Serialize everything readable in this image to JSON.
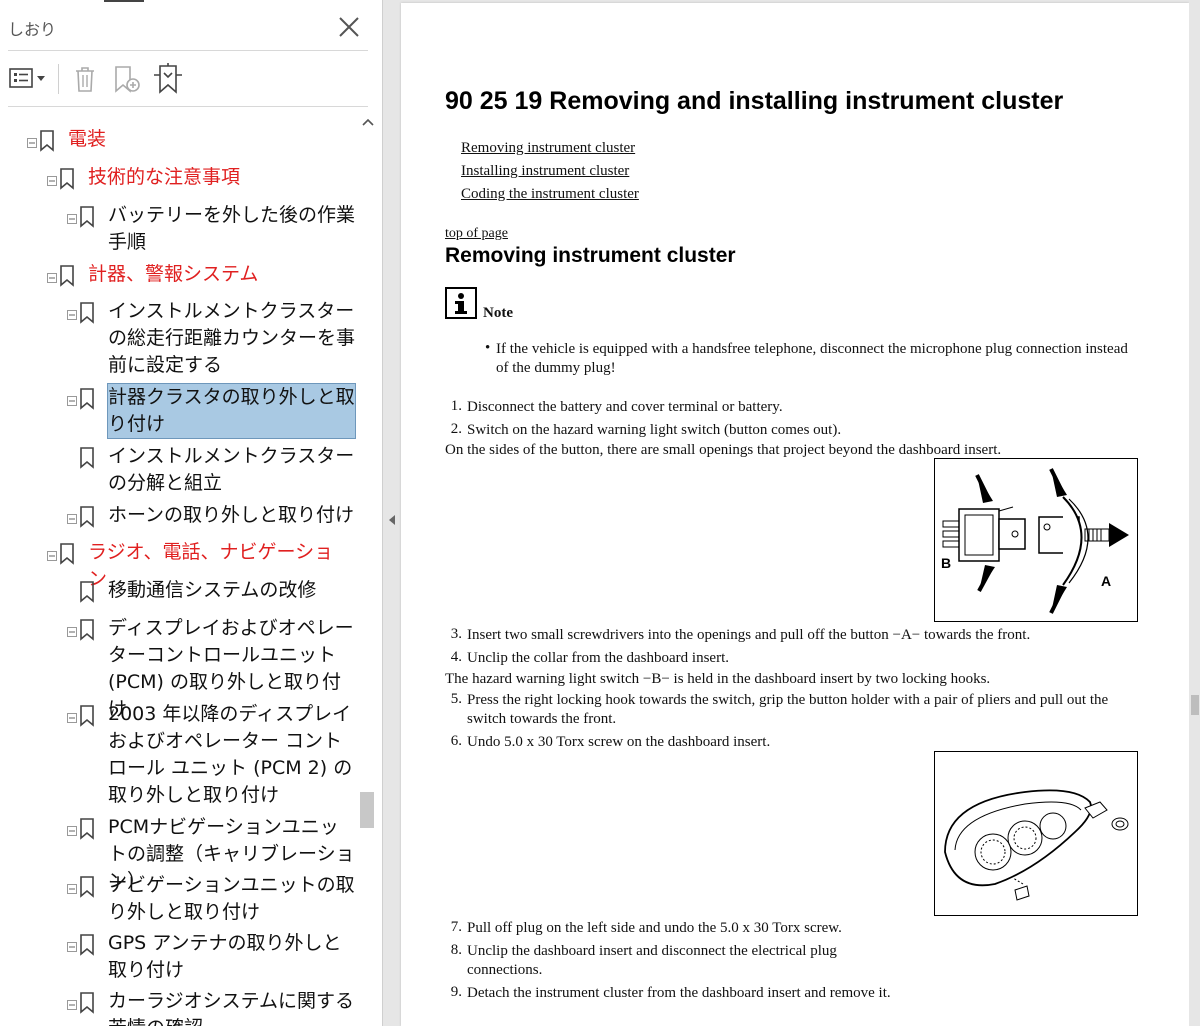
{
  "sidebar": {
    "title": "しおり",
    "items": [
      {
        "label": "電装",
        "red": true
      },
      {
        "label": "技術的な注意事項",
        "red": true
      },
      {
        "label": "バッテリーを外した後の作業手順",
        "red": false
      },
      {
        "label": "計器、警報システム",
        "red": true
      },
      {
        "label": "インストルメントクラスターの総走行距離カウンターを事前に設定する",
        "red": false
      },
      {
        "label": "計器クラスタの取り外しと取り付け",
        "red": false,
        "selected": true
      },
      {
        "label": "インストルメントクラスターの分解と組立",
        "red": false
      },
      {
        "label": "ホーンの取り外しと取り付け",
        "red": false
      },
      {
        "label": "ラジオ、電話、ナビゲーション",
        "red": true
      },
      {
        "label": "移動通信システムの改修",
        "red": false
      },
      {
        "label": "ディスプレイおよびオペレーターコントロールユニット (PCM) の取り外しと取り付け",
        "red": false
      },
      {
        "label": "2003 年以降のディスプレイおよびオペレーター コントロール ユニット (PCM 2) の取り外しと取り付け",
        "red": false
      },
      {
        "label": "PCMナビゲーションユニットの調整（キャリブレーション）",
        "red": false
      },
      {
        "label": "ナビゲーションユニットの取り外しと取り付け",
        "red": false
      },
      {
        "label": "GPS アンテナの取り外しと取り付け",
        "red": false
      },
      {
        "label": "カーラジオシステムに関する苦情の確認",
        "red": false
      }
    ]
  },
  "doc": {
    "title": "90 25 19 Removing and installing instrument cluster",
    "toc": [
      "Removing instrument cluster",
      "Installing instrument cluster",
      "Coding the instrument cluster"
    ],
    "top_link": "top of page",
    "section_title": "Removing instrument cluster",
    "note_label": "Note",
    "note_text": "If the vehicle is equipped with a handsfree telephone, disconnect the microphone plug connection instead of the dummy plug!",
    "steps_a": [
      "Disconnect the battery and cover terminal or battery.",
      "Switch on the hazard warning light switch (button comes out)."
    ],
    "para_a": "On the sides of the button, there are small openings that project beyond the dashboard insert.",
    "steps_b": [
      "Insert two small screwdrivers into the openings and pull off the button −A− towards the front.",
      "Unclip the collar from the dashboard insert."
    ],
    "para_b": "The hazard warning light switch −B− is held in the dashboard insert by two locking hooks.",
    "steps_c": [
      "Press the right locking hook towards the switch, grip the button holder with a pair of pliers and pull out the switch towards the front.",
      "Undo 5.0 x 30 Torx screw on the dashboard insert."
    ],
    "steps_d": [
      "Pull off plug on the left side and undo the 5.0 x 30 Torx screw.",
      "Unclip the dashboard insert and disconnect the electrical plug connections.",
      "Detach the instrument cluster from the dashboard insert and remove it."
    ],
    "fig1_labels": {
      "b": "B",
      "a": "A"
    }
  }
}
